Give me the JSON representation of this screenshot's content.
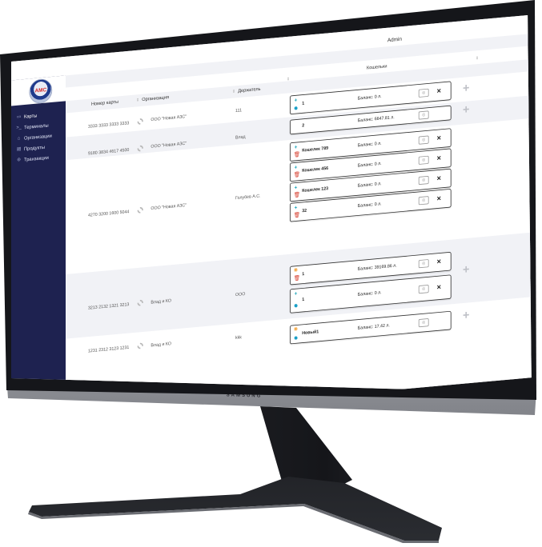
{
  "header": {
    "user": "Admin"
  },
  "logo": {
    "text": "AMC"
  },
  "sidebar": {
    "items": [
      {
        "label": "Карты",
        "icon": "card-icon"
      },
      {
        "label": "Терминалы",
        "icon": "terminal-icon"
      },
      {
        "label": "Организации",
        "icon": "organization-icon"
      },
      {
        "label": "Продукты",
        "icon": "product-icon"
      },
      {
        "label": "Транзакции",
        "icon": "transaction-icon"
      }
    ]
  },
  "table": {
    "columns": [
      "Номер карты",
      "Организация",
      "Держатель",
      "Кошельки"
    ],
    "rows": [
      {
        "card": "3333 3333 3333 3333",
        "org": "ООО \"Новая АЗС\"",
        "holder": "111",
        "wallets": [
          {
            "name": "1",
            "balance": "Баланс: 0 л."
          }
        ]
      },
      {
        "card": "9180 3834 4617 4500",
        "org": "ООО \"Новая АЗС\"",
        "holder": "Влад",
        "wallets": [
          {
            "name": "2",
            "balance": "Баланс: 6647.81 л."
          }
        ]
      },
      {
        "card": "4270 3200 1600 5044",
        "org": "ООО \"Новая АЗС\"",
        "holder": "Голубев А.С.",
        "wallets": [
          {
            "name": "Кошелек 789",
            "balance": "Баланс: 0 л."
          },
          {
            "name": "Кошелек 456",
            "balance": "Баланс: 0 л."
          },
          {
            "name": "Кошелек 123",
            "balance": "Баланс: 0 л."
          },
          {
            "name": "32",
            "balance": "Баланс: 0 л."
          }
        ]
      },
      {
        "card": "3213 2132 1321 3213",
        "org": "Влад и КО",
        "holder": "ООО",
        "wallets": [
          {
            "name": "1",
            "balance": "Баланс: 39169.86 л."
          },
          {
            "name": "1",
            "balance": "Баланс: 0 л."
          }
        ]
      },
      {
        "card": "1231 2312 3123 1231",
        "org": "Влад и КО",
        "holder": "kkk",
        "wallets": [
          {
            "name": "Новый1",
            "balance": "Баланс: 17.42 л."
          }
        ]
      }
    ]
  },
  "device": {
    "brand": "SAMSUNG"
  }
}
